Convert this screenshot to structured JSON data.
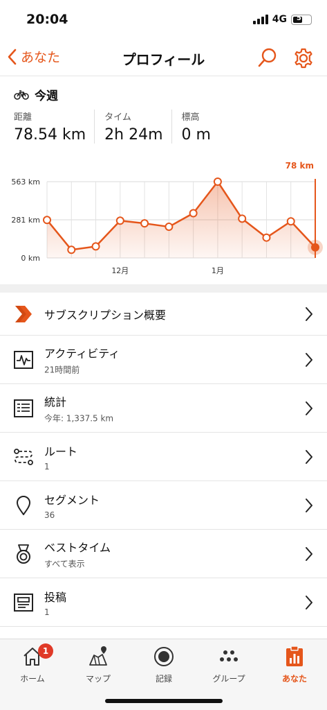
{
  "status": {
    "time": "20:04",
    "network": "4G",
    "battery": "51"
  },
  "nav": {
    "back_label": "あなた",
    "title": "プロフィール"
  },
  "week": {
    "title": "今週",
    "stats": [
      {
        "label": "距離",
        "value": "78.54 km"
      },
      {
        "label": "タイム",
        "value": "2h 24m"
      },
      {
        "label": "標高",
        "value": "0 m"
      }
    ]
  },
  "chart_data": {
    "type": "area",
    "current_value_label": "78 km",
    "y_ticks": [
      "563 km",
      "281 km",
      "0 km"
    ],
    "ylim": [
      0,
      563
    ],
    "x_labels": [
      "12月",
      "1月"
    ],
    "x_label_positions": [
      3,
      7
    ],
    "values": [
      280,
      60,
      85,
      275,
      255,
      230,
      330,
      563,
      290,
      150,
      270,
      78
    ],
    "grid": true,
    "color": "#e5561b"
  },
  "list": [
    {
      "title": "サブスクリプション概要",
      "subtitle": "",
      "icon": "subscription-chevron-icon"
    },
    {
      "title": "アクティビティ",
      "subtitle": "21時間前",
      "icon": "activity-icon"
    },
    {
      "title": "統計",
      "subtitle": "今年: 1,337.5 km",
      "icon": "stats-icon"
    },
    {
      "title": "ルート",
      "subtitle": "1",
      "icon": "route-icon"
    },
    {
      "title": "セグメント",
      "subtitle": "36",
      "icon": "segment-pin-icon"
    },
    {
      "title": "ベストタイム",
      "subtitle": "すべて表示",
      "icon": "medal-icon"
    },
    {
      "title": "投稿",
      "subtitle": "1",
      "icon": "post-icon"
    }
  ],
  "tabs": [
    {
      "label": "ホーム",
      "icon": "home-icon",
      "badge": "1"
    },
    {
      "label": "マップ",
      "icon": "map-icon"
    },
    {
      "label": "記録",
      "icon": "record-icon"
    },
    {
      "label": "グループ",
      "icon": "group-icon"
    },
    {
      "label": "あなた",
      "icon": "you-icon",
      "active": true
    }
  ],
  "colors": {
    "accent": "#e5561b",
    "badge": "#e03a28"
  }
}
